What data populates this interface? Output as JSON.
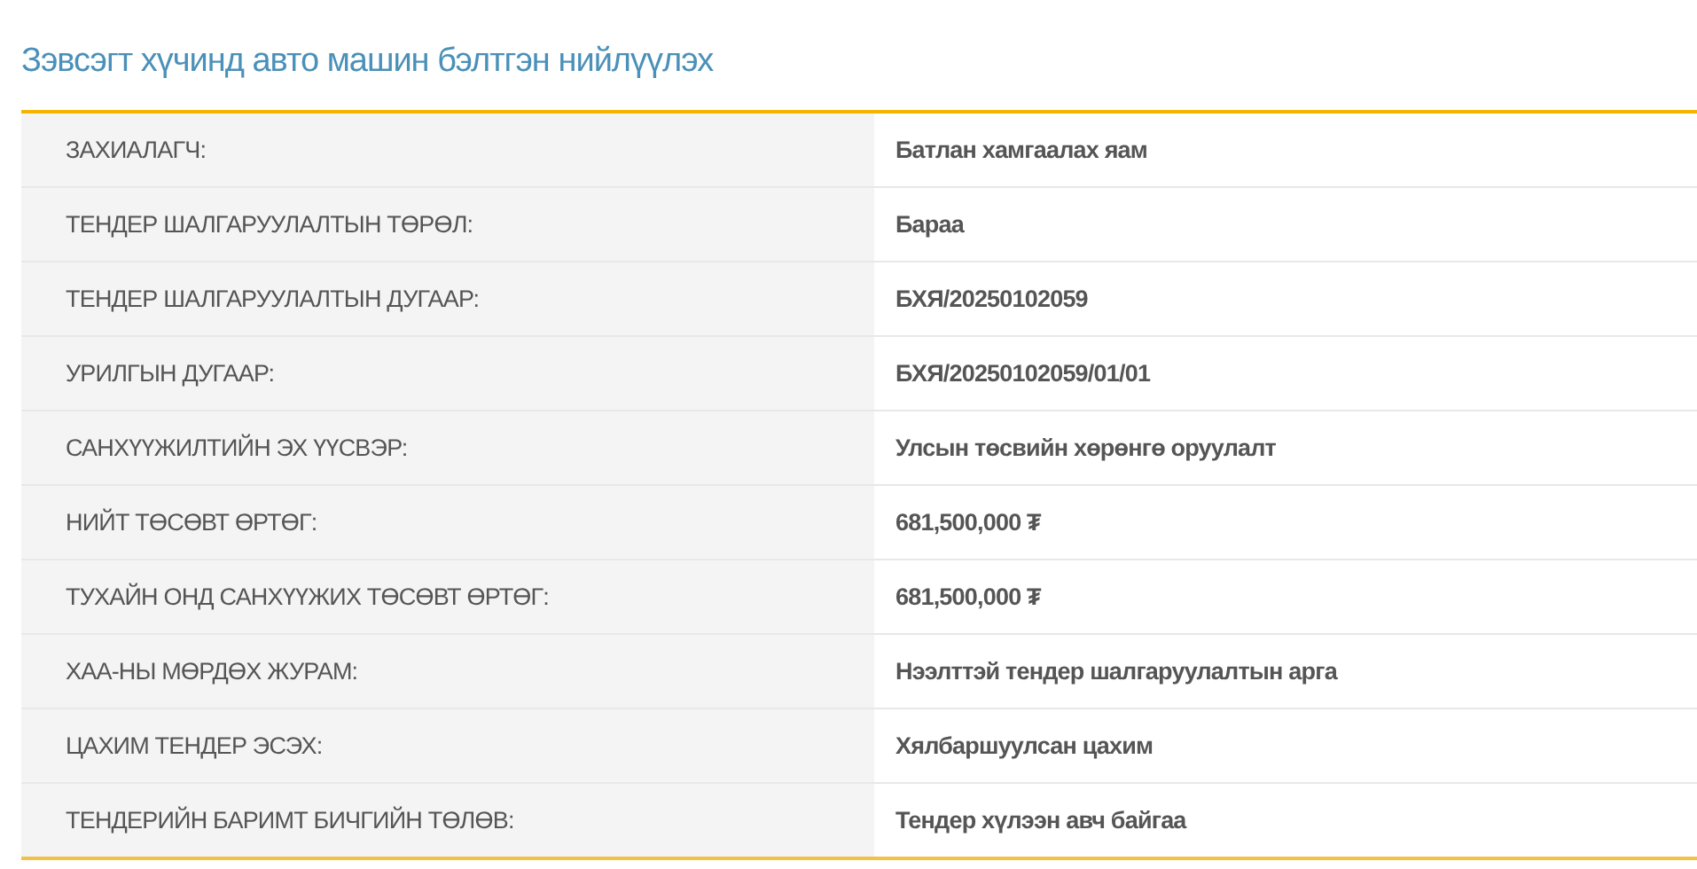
{
  "title": "Зэвсэгт хүчинд авто машин бэлтгэн нийлүүлэх",
  "rows": [
    {
      "label": "ЗАХИАЛАГЧ:",
      "value": "Батлан хамгаалах яам"
    },
    {
      "label": "ТЕНДЕР ШАЛГАРУУЛАЛТЫН ТӨРӨЛ:",
      "value": "Бараа"
    },
    {
      "label": "ТЕНДЕР ШАЛГАРУУЛАЛТЫН ДУГААР:",
      "value": "БХЯ/20250102059"
    },
    {
      "label": "УРИЛГЫН ДУГААР:",
      "value": "БХЯ/20250102059/01/01"
    },
    {
      "label": "САНХҮҮЖИЛТИЙН ЭХ ҮҮСВЭР:",
      "value": "Улсын төсвийн хөрөнгө оруулалт"
    },
    {
      "label": "НИЙТ ТӨСӨВТ ӨРТӨГ:",
      "value": "681,500,000 ₮"
    },
    {
      "label": "ТУХАЙН ОНД САНХҮҮЖИХ ТӨСӨВТ ӨРТӨГ:",
      "value": "681,500,000 ₮"
    },
    {
      "label": "ХАА-НЫ МӨРДӨХ ЖУРАМ:",
      "value": "Нээлттэй тендер шалгаруулалтын арга"
    },
    {
      "label": "ЦАХИМ ТЕНДЕР ЭСЭХ:",
      "value": "Хялбаршуулсан цахим"
    },
    {
      "label": "ТЕНДЕРИЙН БАРИМТ БИЧГИЙН ТӨЛӨВ:",
      "value": "Тендер хүлээн авч байгаа"
    }
  ]
}
